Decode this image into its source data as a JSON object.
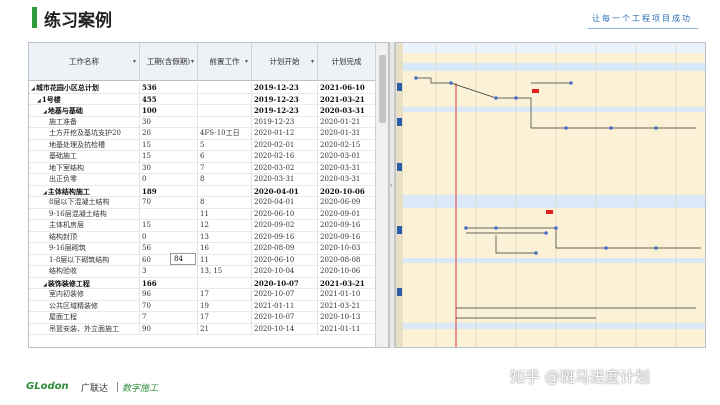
{
  "header": {
    "title": "练习案例",
    "slogan": "让每一个工程项目成功",
    "accent": "#2e9a3a"
  },
  "table": {
    "columns": [
      "工作名称",
      "工期(含假期)",
      "前置工作",
      "计划开始",
      "计划完成"
    ],
    "rows": [
      {
        "name": "城市花园小区总计划",
        "level": 0,
        "bold": true,
        "expand": true,
        "duration": "536",
        "pred": "",
        "start": "2019-12-23",
        "finish": "2021-06-10"
      },
      {
        "name": "1号楼",
        "level": 1,
        "bold": true,
        "expand": true,
        "duration": "455",
        "pred": "",
        "start": "2019-12-23",
        "finish": "2021-03-21"
      },
      {
        "name": "地基与基础",
        "level": 2,
        "bold": true,
        "expand": true,
        "duration": "100",
        "pred": "",
        "start": "2019-12-23",
        "finish": "2020-03-31"
      },
      {
        "name": "施工准备",
        "level": 3,
        "bold": false,
        "expand": false,
        "duration": "30",
        "pred": "",
        "start": "2019-12-23",
        "finish": "2020-01-21"
      },
      {
        "name": "土方开挖及基坑支护20",
        "level": 3,
        "bold": false,
        "expand": false,
        "duration": "20",
        "pred": "4FS-10工日",
        "start": "2020-01-12",
        "finish": "2020-01-31"
      },
      {
        "name": "地基处理及抗检槽",
        "level": 3,
        "bold": false,
        "expand": false,
        "duration": "15",
        "pred": "5",
        "start": "2020-02-01",
        "finish": "2020-02-15"
      },
      {
        "name": "基础施工",
        "level": 3,
        "bold": false,
        "expand": false,
        "duration": "15",
        "pred": "6",
        "start": "2020-02-16",
        "finish": "2020-03-01"
      },
      {
        "name": "地下室结构",
        "level": 3,
        "bold": false,
        "expand": false,
        "duration": "30",
        "pred": "7",
        "start": "2020-03-02",
        "finish": "2020-03-31"
      },
      {
        "name": "出正负零",
        "level": 3,
        "bold": false,
        "expand": false,
        "duration": "0",
        "pred": "8",
        "start": "2020-03-31",
        "finish": "2020-03-31"
      },
      {
        "name": "主体结构施工",
        "level": 2,
        "bold": true,
        "expand": true,
        "duration": "189",
        "pred": "",
        "start": "2020-04-01",
        "finish": "2020-10-06"
      },
      {
        "name": "8层以下混凝土结构",
        "level": 3,
        "bold": false,
        "expand": false,
        "duration": "70",
        "pred": "8",
        "start": "2020-04-01",
        "finish": "2020-06-09"
      },
      {
        "name": "9-16层混凝土结构",
        "level": 3,
        "bold": false,
        "expand": false,
        "duration": "",
        "pred": "11",
        "start": "2020-06-10",
        "finish": "2020-09-01"
      },
      {
        "name": "主体机房层",
        "level": 3,
        "bold": false,
        "expand": false,
        "duration": "15",
        "pred": "12",
        "start": "2020-09-02",
        "finish": "2020-09-16"
      },
      {
        "name": "结构封顶",
        "level": 3,
        "bold": false,
        "expand": false,
        "duration": "0",
        "pred": "13",
        "start": "2020-09-16",
        "finish": "2020-09-16"
      },
      {
        "name": "9-16层砌筑",
        "level": 3,
        "bold": false,
        "expand": false,
        "duration": "56",
        "pred": "16",
        "start": "2020-08-09",
        "finish": "2020-10-03"
      },
      {
        "name": "1-8层以下砌筑结构",
        "level": 3,
        "bold": false,
        "expand": false,
        "duration": "60",
        "pred": "11",
        "start": "2020-06-10",
        "finish": "2020-08-08"
      },
      {
        "name": "结构验收",
        "level": 3,
        "bold": false,
        "expand": false,
        "duration": "3",
        "pred": "13, 15",
        "start": "2020-10-04",
        "finish": "2020-10-06"
      },
      {
        "name": "装饰装修工程",
        "level": 2,
        "bold": true,
        "expand": true,
        "duration": "166",
        "pred": "",
        "start": "2020-10-07",
        "finish": "2021-03-21"
      },
      {
        "name": "室内初装修",
        "level": 3,
        "bold": false,
        "expand": false,
        "duration": "96",
        "pred": "17",
        "start": "2020-10-07",
        "finish": "2021-01-10"
      },
      {
        "name": "公共区域精装修",
        "level": 3,
        "bold": false,
        "expand": false,
        "duration": "70",
        "pred": "19",
        "start": "2021-01-11",
        "finish": "2021-03-21"
      },
      {
        "name": "屋面工程",
        "level": 3,
        "bold": false,
        "expand": false,
        "duration": "7",
        "pred": "17",
        "start": "2020-10-07",
        "finish": "2020-10-13"
      },
      {
        "name": "吊篮安装、外立面施工",
        "level": 3,
        "bold": false,
        "expand": false,
        "duration": "90",
        "pred": "21",
        "start": "2020-10-14",
        "finish": "2021-01-11"
      }
    ],
    "edit_value": "84"
  },
  "footer": {
    "logo": "GLodon",
    "company": "广联达",
    "tagline": "数字施工",
    "watermark": "知乎 @斑马进度计划"
  }
}
